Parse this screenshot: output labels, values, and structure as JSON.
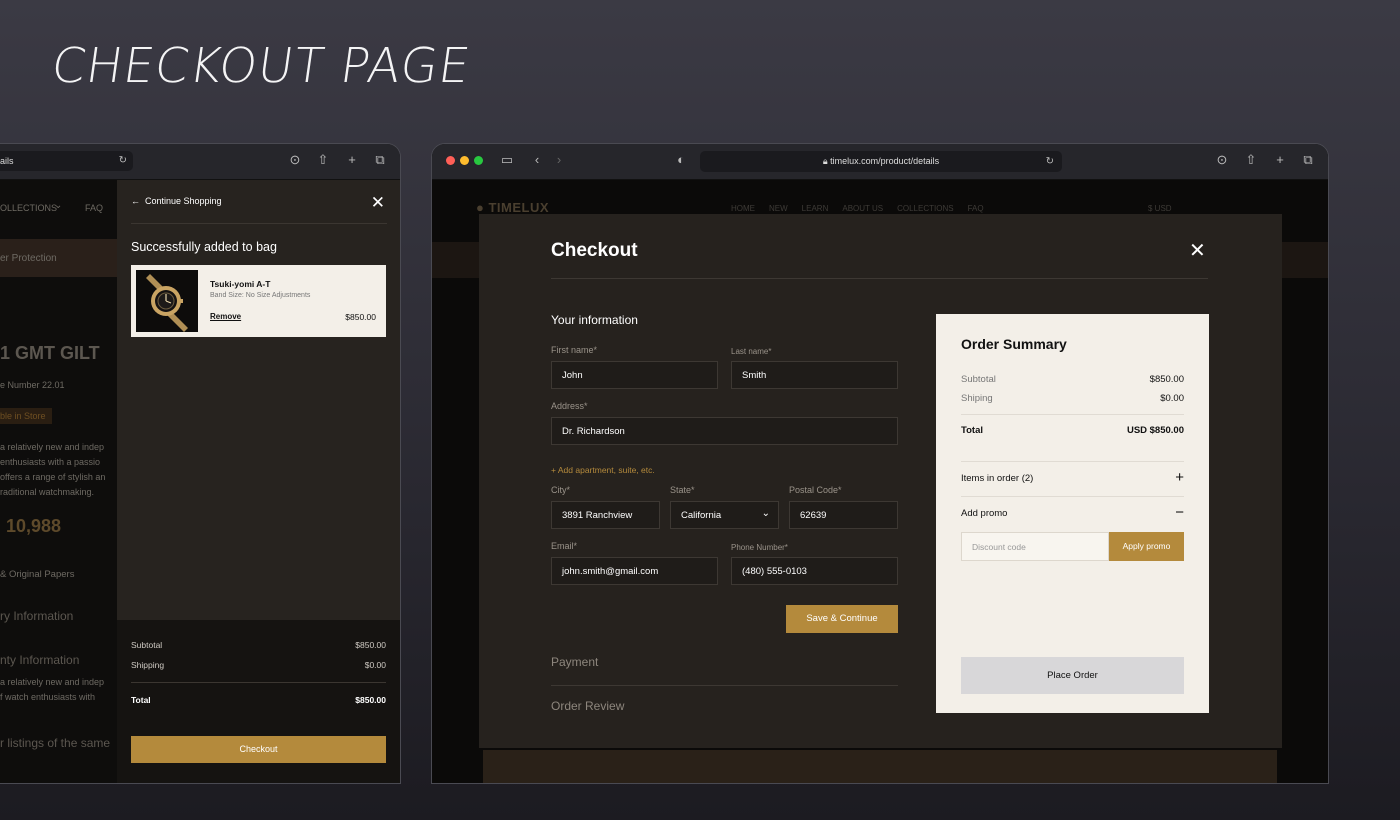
{
  "heading": "CHECKOUT PAGE",
  "left_browser": {
    "url": "ails",
    "site": {
      "nav_collections": "OLLECTIONS",
      "nav_faq": "FAQ",
      "banner": "er Protection",
      "product_title": "1 GMT GILT",
      "reference": "e Number 22.01",
      "availability": "ble in Store",
      "desc_lines": [
        "a relatively new and indep",
        "enthusiasts with a passio",
        "offers a range of stylish an",
        "raditional watchmaking."
      ],
      "price": "10,988",
      "papers": "& Original Papers",
      "delivery": "ry Information",
      "warranty": "nty Information",
      "warranty_desc_lines": [
        "a relatively new and indep",
        "f watch enthusiasts with"
      ],
      "more_listings": "r listings of the same"
    },
    "drawer": {
      "back_label": "Continue Shopping",
      "title": "Successfully added to bag",
      "item": {
        "name": "Tsuki-yomi A-T",
        "size": "Band Size: No Size Adjustments",
        "remove": "Remove",
        "price": "$850.00"
      },
      "subtotal_label": "Subtotal",
      "subtotal": "$850.00",
      "shipping_label": "Shipping",
      "shipping": "$0.00",
      "total_label": "Total",
      "total": "$850.00",
      "checkout_label": "Checkout"
    }
  },
  "right_browser": {
    "url": "timelux.com/product/details",
    "site": {
      "logo": "TIMELUX",
      "nav": [
        "HOME",
        "NEW",
        "LEARN",
        "ABOUT US",
        "COLLECTIONS",
        "FAQ"
      ],
      "currency": "$ USD"
    },
    "checkout": {
      "title": "Checkout",
      "section": "Your information",
      "first_name_label": "First name*",
      "first_name": "John",
      "last_name_label": "Last name*",
      "last_name": "Smith",
      "address_label": "Address*",
      "address": "Dr. Richardson",
      "add_apartment": "Add apartment, suite, etc.",
      "city_label": "City*",
      "city": "3891 Ranchview",
      "state_label": "State*",
      "state": "California",
      "postal_label": "Postal Code*",
      "postal": "62639",
      "email_label": "Email*",
      "email": "john.smith@gmail.com",
      "phone_label": "Phone Number*",
      "phone": "(480) 555-0103",
      "save_label": "Save & Continue",
      "payment_label": "Payment",
      "review_label": "Order Review"
    },
    "summary": {
      "title": "Order Summary",
      "subtotal_label": "Subtotal",
      "subtotal": "$850.00",
      "shipping_label": "Shiping",
      "shipping": "$0.00",
      "total_label": "Total",
      "total": "USD  $850.00",
      "items_label": "Items in order (2)",
      "promo_label": "Add promo",
      "discount_placeholder": "Discount code",
      "apply_label": "Apply promo",
      "place_order_label": "Place Order"
    }
  },
  "colors": {
    "accent": "#b48a3c",
    "modal_bg": "#26221e",
    "summary_bg": "#f3efe8"
  }
}
